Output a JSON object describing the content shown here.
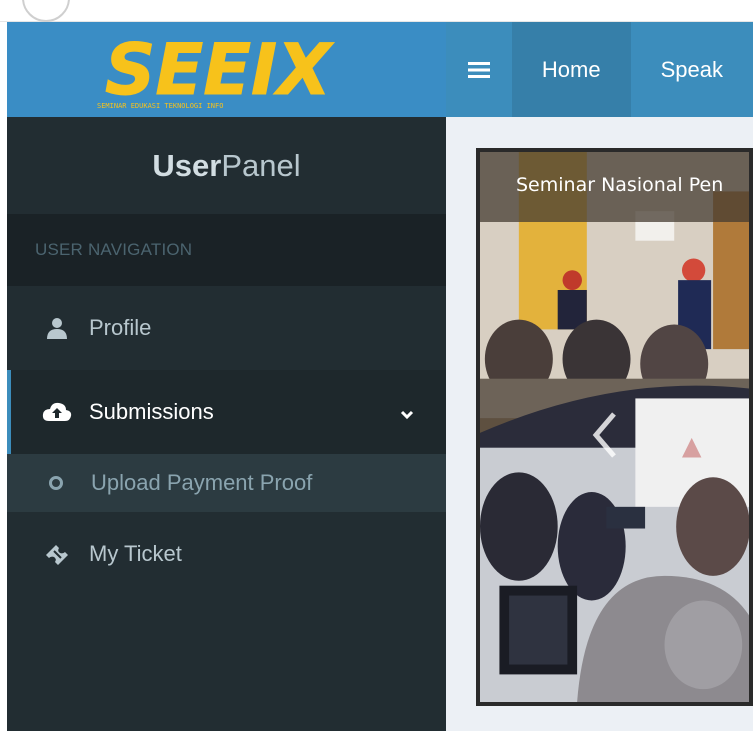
{
  "header": {
    "logo_text": "SEEIX",
    "logo_tagline": "SEMINAR EDUKASI TEKNOLOGI INFO",
    "nav_items": [
      {
        "label": "Home"
      },
      {
        "label": "Speak"
      }
    ]
  },
  "sidebar": {
    "title_bold": "User",
    "title_rest": "Panel",
    "section_header": "USER NAVIGATION",
    "items": [
      {
        "label": "Profile",
        "icon": "user-icon"
      },
      {
        "label": "Submissions",
        "icon": "cloud-upload-icon",
        "expanded": true,
        "children": [
          {
            "label": "Upload Payment Proof",
            "icon": "circle-icon"
          }
        ]
      },
      {
        "label": "My Ticket",
        "icon": "ticket-icon"
      }
    ]
  },
  "carousel": {
    "caption": "Seminar Nasional Pen"
  },
  "colors": {
    "header": "#3c8dbc",
    "sidebar": "#222d32",
    "logo": "#f7c21b",
    "content_bg": "#ecf0f5"
  }
}
